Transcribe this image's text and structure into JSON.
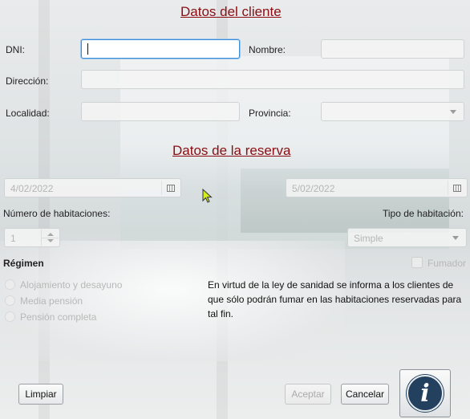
{
  "cliente": {
    "title": "Datos del cliente",
    "dni_label": "DNI:",
    "dni_value": "",
    "nombre_label": "Nombre:",
    "nombre_value": "",
    "direccion_label": "Dirección:",
    "direccion_value": "",
    "localidad_label": "Localidad:",
    "localidad_value": "",
    "provincia_label": "Provincia:",
    "provincia_value": ""
  },
  "reserva": {
    "title": "Datos de la reserva",
    "fecha_entrada": "4/02/2022",
    "fecha_salida": "5/02/2022",
    "num_habitaciones_label": "Número de habitaciones:",
    "num_habitaciones_value": "1",
    "tipo_habitacion_label": "Tipo de habitación:",
    "tipo_habitacion_value": "Simple",
    "regimen_label": "Régimen",
    "regimen_options": [
      "Alojamiento y desayuno",
      "Media pensión",
      "Pensión completa"
    ],
    "fumador_label": "Fumador",
    "notice": "En virtud de la ley de sanidad se informa a los clientes de que sólo podrán fumar en las habitaciones reservadas para tal fin."
  },
  "buttons": {
    "limpiar": "Limpiar",
    "aceptar": "Aceptar",
    "cancelar": "Cancelar",
    "info_icon_text": "i"
  },
  "colors": {
    "title": "#8b0d12",
    "info_icon": "#23415e",
    "focus": "#3b8ed6"
  }
}
